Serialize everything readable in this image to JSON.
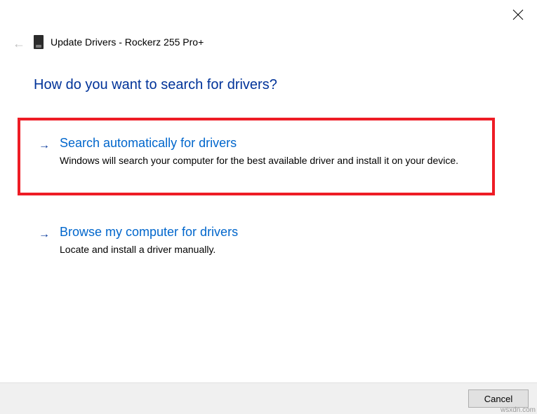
{
  "window": {
    "title": "Update Drivers - Rockerz 255 Pro+"
  },
  "heading": "How do you want to search for drivers?",
  "options": [
    {
      "title": "Search automatically for drivers",
      "description": "Windows will search your computer for the best available driver and install it on your device.",
      "highlighted": true
    },
    {
      "title": "Browse my computer for drivers",
      "description": "Locate and install a driver manually.",
      "highlighted": false
    }
  ],
  "footer": {
    "cancel_label": "Cancel"
  },
  "watermark": "wsxdn.com"
}
